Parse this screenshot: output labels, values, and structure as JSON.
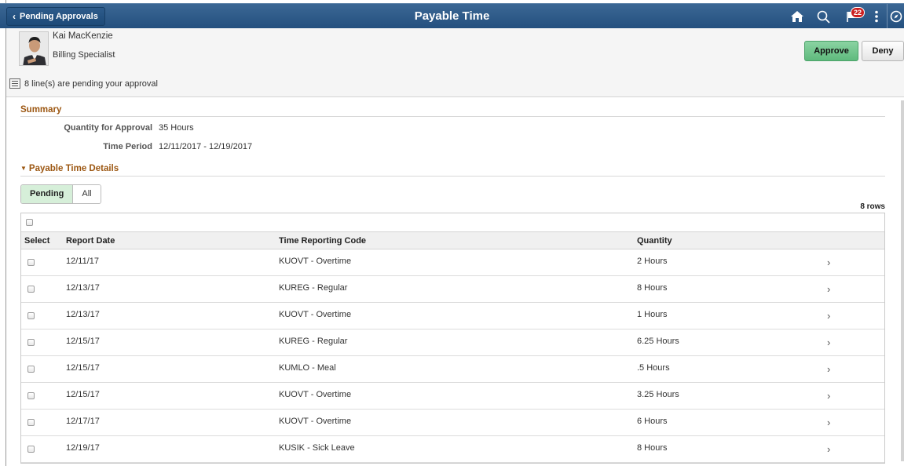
{
  "header": {
    "back_label": "Pending Approvals",
    "title": "Payable Time",
    "notification_count": "22"
  },
  "approver": {
    "name": "Kai MacKenzie",
    "job_title": "Billing Specialist",
    "approve_label": "Approve",
    "deny_label": "Deny",
    "pending_text": "8 line(s) are pending your approval"
  },
  "summary": {
    "heading": "Summary",
    "quantity_label": "Quantity for Approval",
    "quantity_value": "35 Hours",
    "period_label": "Time Period",
    "period_value": "12/11/2017 - 12/19/2017"
  },
  "details": {
    "heading": "Payable Time Details",
    "tabs": [
      "Pending",
      "All"
    ],
    "active_tab": "Pending",
    "rows_count": "8 rows",
    "columns": [
      "Select",
      "Report Date",
      "Time Reporting Code",
      "Quantity"
    ],
    "rows": [
      {
        "date": "12/11/17",
        "trc": "KUOVT - Overtime",
        "qty": "2 Hours"
      },
      {
        "date": "12/13/17",
        "trc": "KUREG - Regular",
        "qty": "8 Hours"
      },
      {
        "date": "12/13/17",
        "trc": "KUOVT - Overtime",
        "qty": "1 Hours"
      },
      {
        "date": "12/15/17",
        "trc": "KUREG - Regular",
        "qty": "6.25 Hours"
      },
      {
        "date": "12/15/17",
        "trc": "KUMLO - Meal",
        "qty": ".5 Hours"
      },
      {
        "date": "12/15/17",
        "trc": "KUOVT - Overtime",
        "qty": "3.25 Hours"
      },
      {
        "date": "12/17/17",
        "trc": "KUOVT - Overtime",
        "qty": "6 Hours"
      },
      {
        "date": "12/19/17",
        "trc": "KUSIK - Sick Leave",
        "qty": "8 Hours"
      }
    ]
  },
  "icons": [
    "chevron-left-icon",
    "home-icon",
    "search-icon",
    "flag-icon",
    "more-vertical-icon",
    "compass-icon",
    "lines-icon",
    "chevron-right-icon",
    "triangle-down-icon"
  ],
  "colors": {
    "header_bg": "#2a5787",
    "section_heading": "#9c5712",
    "approve_bg": "#6cc18a",
    "pending_tab_bg": "#d6efd9",
    "badge_bg": "#cc1f1f"
  }
}
